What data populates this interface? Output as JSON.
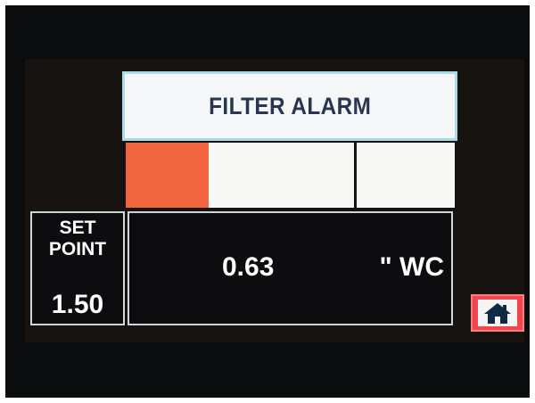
{
  "header": {
    "title": "FILTER ALARM"
  },
  "setpoint": {
    "label_line1": "SET",
    "label_line2": "POINT",
    "value": "1.50"
  },
  "reading": {
    "value": "0.63",
    "unit": "\" WC"
  },
  "home_button": {
    "icon": "home-icon"
  },
  "colors": {
    "alarm_bar": "#f2643e",
    "title_border": "#a9dbe8",
    "home_button": "#f0474f"
  }
}
